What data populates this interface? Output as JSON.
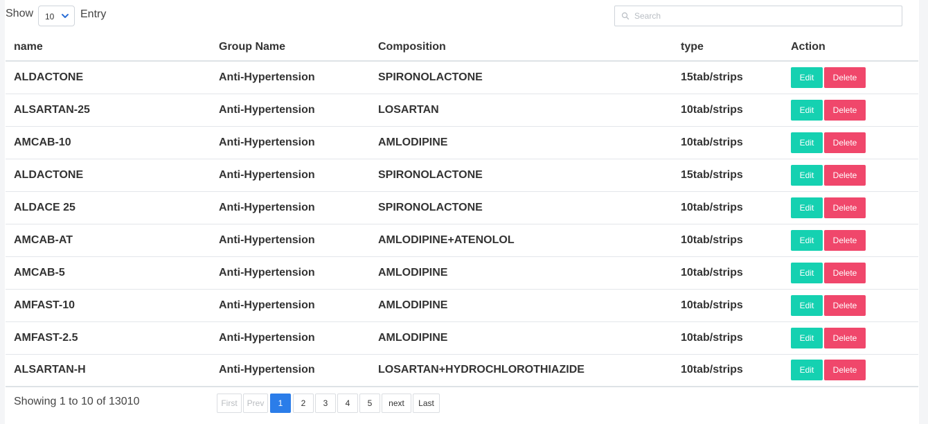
{
  "toolbar": {
    "show_label": "Show",
    "entry_value": "10",
    "entry_label": "Entry",
    "search_placeholder": "Search",
    "search_value": ""
  },
  "table": {
    "columns": [
      "name",
      "Group Name",
      "Composition",
      "type",
      "Action"
    ],
    "rows": [
      {
        "name": "ALDACTONE",
        "group": "Anti-Hypertension",
        "composition": "SPIRONOLACTONE",
        "type": "15tab/strips"
      },
      {
        "name": "ALSARTAN-25",
        "group": "Anti-Hypertension",
        "composition": "LOSARTAN",
        "type": "10tab/strips"
      },
      {
        "name": "AMCAB-10",
        "group": "Anti-Hypertension",
        "composition": "AMLODIPINE",
        "type": "10tab/strips"
      },
      {
        "name": "ALDACTONE",
        "group": "Anti-Hypertension",
        "composition": "SPIRONOLACTONE",
        "type": "15tab/strips"
      },
      {
        "name": "ALDACE 25",
        "group": "Anti-Hypertension",
        "composition": "SPIRONOLACTONE",
        "type": "10tab/strips"
      },
      {
        "name": "AMCAB-AT",
        "group": "Anti-Hypertension",
        "composition": "AMLODIPINE+ATENOLOL",
        "type": "10tab/strips"
      },
      {
        "name": "AMCAB-5",
        "group": "Anti-Hypertension",
        "composition": "AMLODIPINE",
        "type": "10tab/strips"
      },
      {
        "name": "AMFAST-10",
        "group": "Anti-Hypertension",
        "composition": "AMLODIPINE",
        "type": "10tab/strips"
      },
      {
        "name": "AMFAST-2.5",
        "group": "Anti-Hypertension",
        "composition": "AMLODIPINE",
        "type": "10tab/strips"
      },
      {
        "name": "ALSARTAN-H",
        "group": "Anti-Hypertension",
        "composition": "LOSARTAN+HYDROCHLOROTHIAZIDE",
        "type": "10tab/strips"
      }
    ],
    "edit_label": "Edit",
    "delete_label": "Delete"
  },
  "footer": {
    "showing_text": "Showing 1 to 10 of 13010",
    "pages": [
      {
        "label": "First",
        "state": "disabled"
      },
      {
        "label": "Prev",
        "state": "disabled"
      },
      {
        "label": "1",
        "state": "active"
      },
      {
        "label": "2",
        "state": "normal"
      },
      {
        "label": "3",
        "state": "normal"
      },
      {
        "label": "4",
        "state": "normal"
      },
      {
        "label": "5",
        "state": "normal"
      },
      {
        "label": "next",
        "state": "normal"
      },
      {
        "label": "Last",
        "state": "normal"
      }
    ]
  },
  "colors": {
    "edit": "#15d1b1",
    "delete": "#f0476b",
    "active_page": "#2b7de9"
  }
}
